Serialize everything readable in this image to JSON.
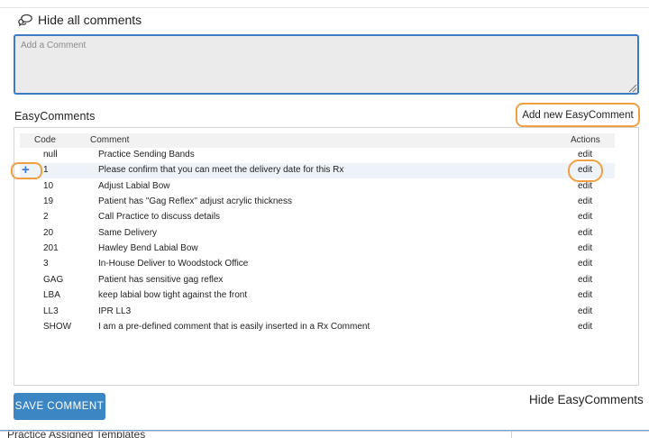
{
  "comments": {
    "hide_all_label": "Hide all comments",
    "placeholder": "Add a Comment",
    "value": ""
  },
  "easycomments": {
    "title": "EasyComments",
    "add_label": "Add new EasyComment",
    "columns": {
      "code": "Code",
      "comment": "Comment",
      "actions": "Actions"
    },
    "rows": [
      {
        "code": "null",
        "comment": "Practice Sending Bands",
        "action": "edit"
      },
      {
        "code": "1",
        "comment": "Please confirm that you can meet the delivery date for this Rx",
        "action": "edit"
      },
      {
        "code": "10",
        "comment": "Adjust Labial Bow",
        "action": "edit"
      },
      {
        "code": "19",
        "comment": "Patient has \"Gag Reflex\" adjust acrylic thickness",
        "action": "edit"
      },
      {
        "code": "2",
        "comment": "Call Practice to discuss details",
        "action": "edit"
      },
      {
        "code": "20",
        "comment": "Same Delivery",
        "action": "edit"
      },
      {
        "code": "201",
        "comment": "Hawley Bend Labial Bow",
        "action": "edit"
      },
      {
        "code": "3",
        "comment": "In-House Deliver to Woodstock Office",
        "action": "edit"
      },
      {
        "code": "GAG",
        "comment": "Patient has sensitive gag reflex",
        "action": "edit"
      },
      {
        "code": "LBA",
        "comment": "keep labial bow tight against the front",
        "action": "edit"
      },
      {
        "code": "LL3",
        "comment": "IPR LL3",
        "action": "edit"
      },
      {
        "code": "SHOW",
        "comment": "I am a pre-defined comment that is easily inserted in a Rx Comment",
        "action": "edit"
      }
    ],
    "insert_symbol": "+",
    "hide_label": "Hide EasyComments"
  },
  "actions": {
    "save_label": "SAVE COMMENT"
  },
  "footer": {
    "partial_text": "Practice Assigned Templates"
  },
  "icons": {
    "comments": "comments-icon",
    "plus": "plus-icon"
  },
  "colors": {
    "accent_blue": "#3d86c4",
    "focus_border": "#3d7bc4",
    "highlight_ring": "#f0a040",
    "row_highlight": "#eef3fa",
    "input_bg": "#ebebeb"
  }
}
